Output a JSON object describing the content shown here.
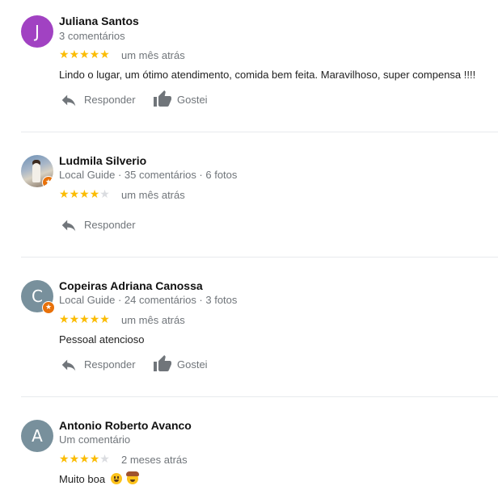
{
  "actions": {
    "reply_label": "Responder",
    "like_label": "Gostei"
  },
  "colors": {
    "star": "#fbbc04",
    "star_off": "#dadce0",
    "meta": "#70757a",
    "local_guide_badge": "#e8710a"
  },
  "reviews": [
    {
      "initial": "J",
      "avatar_color": "#a142c2",
      "local_guide": false,
      "name": "Juliana Santos",
      "meta": "3 comentários",
      "rating": 5,
      "date": "um mês atrás",
      "text": "Lindo o lugar, um ótimo atendimento, comida bem feita. Maravilhoso, super compensa !!!!"
    },
    {
      "initial": "",
      "avatar_color": "#8ea3bd",
      "local_guide": true,
      "name": "Ludmila Silverio",
      "meta": "Local Guide · 35 comentários · 6 fotos",
      "rating": 4,
      "date": "um mês atrás",
      "text": ""
    },
    {
      "initial": "C",
      "avatar_color": "#78909c",
      "local_guide": true,
      "name": "Copeiras Adriana Canossa",
      "meta": "Local Guide · 24 comentários · 3 fotos",
      "rating": 5,
      "date": "um mês atrás",
      "text": "Pessoal atencioso"
    },
    {
      "initial": "A",
      "avatar_color": "#78909c",
      "local_guide": false,
      "name": "Antonio Roberto Avanco",
      "meta": "Um comentário",
      "rating": 4,
      "date": "2 meses atrás",
      "text": "Muito boa"
    }
  ]
}
